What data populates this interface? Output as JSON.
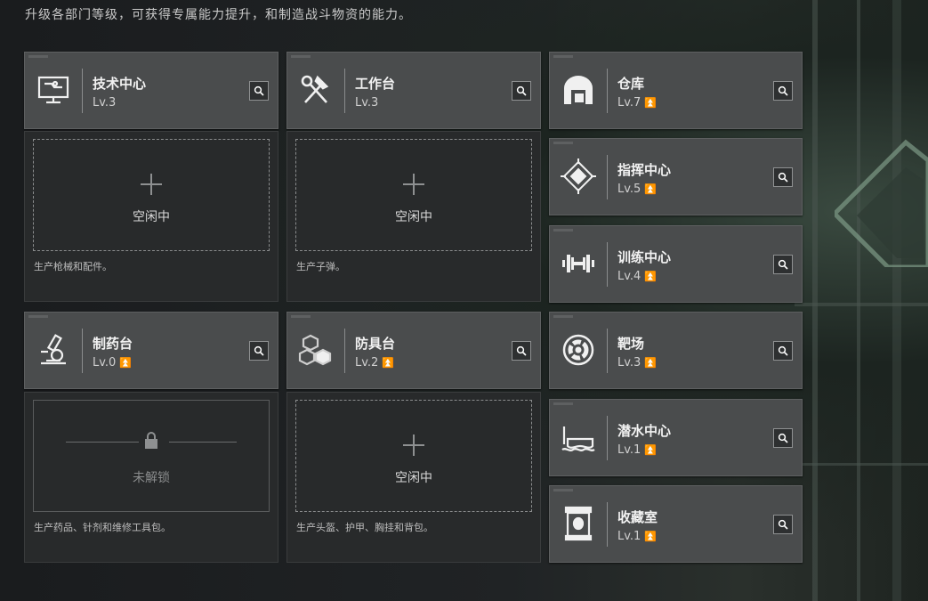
{
  "description": "升级各部门等级，可获得专属能力提升，和制造战斗物资的能力。",
  "colors": {
    "upgrade_arrow": "#d9a84a",
    "card_bg": "#4a4c4d",
    "slot_bg": "#282a2b"
  },
  "left_departments": [
    {
      "name": "技术中心",
      "level": "Lv.3",
      "icon": "monitor-icon",
      "slot_state": "空闲中",
      "slot_desc": "生产枪械和配件。"
    },
    {
      "name": "工作台",
      "level": "Lv.3",
      "icon": "hammer-wrench-icon",
      "slot_state": "空闲中",
      "slot_desc": "生产子弹。"
    },
    {
      "name": "制药台",
      "level": "Lv.0",
      "icon": "microscope-icon",
      "slot_state": "未解锁",
      "slot_desc": "生产药品、针剂和维修工具包。"
    },
    {
      "name": "防具台",
      "level": "Lv.2",
      "icon": "armor-hex-icon",
      "slot_state": "空闲中",
      "slot_desc": "生产头盔、护甲、胸挂和背包。"
    }
  ],
  "right_departments": [
    {
      "name": "仓库",
      "level": "Lv.7",
      "icon": "warehouse-icon"
    },
    {
      "name": "指挥中心",
      "level": "Lv.5",
      "icon": "command-chip-icon"
    },
    {
      "name": "训练中心",
      "level": "Lv.4",
      "icon": "dumbbell-icon"
    },
    {
      "name": "靶场",
      "level": "Lv.3",
      "icon": "target-icon"
    },
    {
      "name": "潜水中心",
      "level": "Lv.1",
      "icon": "diving-mask-icon"
    },
    {
      "name": "收藏室",
      "level": "Lv.1",
      "icon": "display-case-icon"
    }
  ]
}
